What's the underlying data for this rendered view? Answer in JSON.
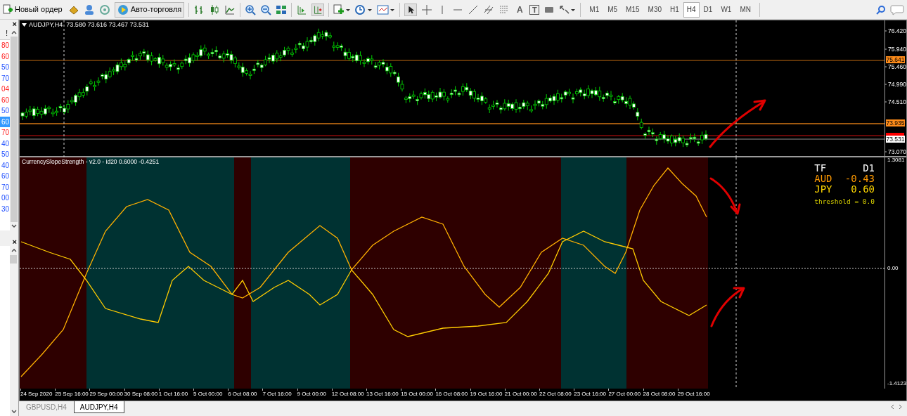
{
  "toolbar": {
    "new_order": "Новый ордер",
    "autotrading": "Авто-торговля",
    "text_tool": "A",
    "label_tool": "T",
    "timeframes": [
      {
        "label": "M1",
        "selected": false
      },
      {
        "label": "M5",
        "selected": false
      },
      {
        "label": "M15",
        "selected": false
      },
      {
        "label": "M30",
        "selected": false
      },
      {
        "label": "H1",
        "selected": false
      },
      {
        "label": "H4",
        "selected": true
      },
      {
        "label": "D1",
        "selected": false
      },
      {
        "label": "W1",
        "selected": false
      },
      {
        "label": "MN",
        "selected": false
      }
    ]
  },
  "market_watch": {
    "close": "×",
    "column_1": "!",
    "prices": [
      {
        "text": "80",
        "kind": "down",
        "selected": false
      },
      {
        "text": "60",
        "kind": "down",
        "selected": false
      },
      {
        "text": "50",
        "kind": "up",
        "selected": false
      },
      {
        "text": "70",
        "kind": "up",
        "selected": false
      },
      {
        "text": "04",
        "kind": "down",
        "selected": false
      },
      {
        "text": "60",
        "kind": "down",
        "selected": false
      },
      {
        "text": "50",
        "kind": "up",
        "selected": false
      },
      {
        "text": "60",
        "kind": "up",
        "selected": true
      },
      {
        "text": "70",
        "kind": "down",
        "selected": false
      },
      {
        "text": "40",
        "kind": "up",
        "selected": false
      },
      {
        "text": "50",
        "kind": "up",
        "selected": false
      },
      {
        "text": "40",
        "kind": "up",
        "selected": false
      },
      {
        "text": "60",
        "kind": "up",
        "selected": false
      },
      {
        "text": "70",
        "kind": "up",
        "selected": false
      },
      {
        "text": "00",
        "kind": "up",
        "selected": false
      },
      {
        "text": "30",
        "kind": "up",
        "selected": false
      }
    ]
  },
  "navigator": {
    "close": "×"
  },
  "chart": {
    "symbol": "AUDJPY,H4",
    "ohlc": "73.580 73.616 73.467 73.531",
    "price_ticks": [
      "76.420",
      "75.940",
      "75.460",
      "74.990",
      "74.510",
      "73.070"
    ],
    "price_tags": [
      {
        "text": "75.641",
        "color": "#ff8c1a"
      },
      {
        "text": "73.935",
        "color": "#ff8c1a"
      },
      {
        "text": "73.531",
        "color": "#ffffff"
      }
    ]
  },
  "indicator": {
    "title": "CurrencySlopeStrength - v2.0 - id20 0.6000 -0.4251",
    "axis": [
      "1.3081",
      "0.00",
      "-1.4123"
    ],
    "tf_label": "TF",
    "tf_value": "D1",
    "rows": [
      {
        "currency": "AUD",
        "value": "-0.43",
        "color": "#ff9900"
      },
      {
        "currency": "JPY",
        "value": "0.60",
        "color": "#ffd700"
      }
    ],
    "threshold": "threshold = 0.0"
  },
  "time_axis": [
    "24 Sep 2020",
    "25 Sep 16:00",
    "29 Sep 00:00",
    "30 Sep 08:00",
    "1 Oct 16:00",
    "5 Oct 00:00",
    "6 Oct 08:00",
    "7 Oct 16:00",
    "9 Oct 00:00",
    "12 Oct 08:00",
    "13 Oct 16:00",
    "15 Oct 00:00",
    "16 Oct 08:00",
    "19 Oct 16:00",
    "21 Oct 00:00",
    "22 Oct 08:00",
    "23 Oct 16:00",
    "27 Oct 00:00",
    "28 Oct 08:00",
    "29 Oct 16:00"
  ],
  "tabs": [
    {
      "label": "GBPUSD,H4",
      "selected": false
    },
    {
      "label": "AUDJPY,H4",
      "selected": true
    }
  ]
}
